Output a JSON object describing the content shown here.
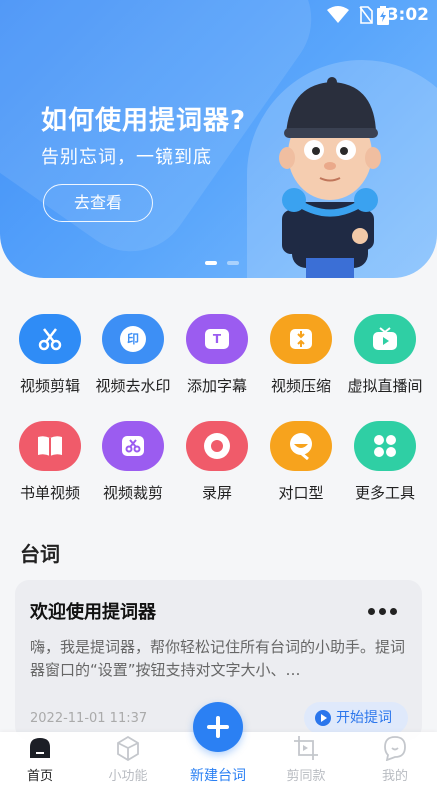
{
  "status_bar": {
    "time": "3:02"
  },
  "hero": {
    "title": "如何使用提词器?",
    "subtitle": "告别忘词，一镜到底",
    "button_label": "去查看"
  },
  "features": [
    {
      "label": "视频剪辑",
      "icon": "scissors-icon",
      "color": "#2f8cf6"
    },
    {
      "label": "视频去水印",
      "icon": "watermark-icon",
      "color": "#3d8ff5",
      "glyph": "印"
    },
    {
      "label": "添加字幕",
      "icon": "subtitle-icon",
      "color": "#9b5cf0",
      "glyph": "T"
    },
    {
      "label": "视频压缩",
      "icon": "compress-icon",
      "color": "#f7a31d"
    },
    {
      "label": "虚拟直播间",
      "icon": "live-tv-icon",
      "color": "#2fcfa4"
    },
    {
      "label": "书单视频",
      "icon": "book-icon",
      "color": "#f05b6a"
    },
    {
      "label": "视频裁剪",
      "icon": "crop-video-icon",
      "color": "#9b5cf0"
    },
    {
      "label": "录屏",
      "icon": "record-icon",
      "color": "#f05b6a"
    },
    {
      "label": "对口型",
      "icon": "lipsync-icon",
      "color": "#f7a31d"
    },
    {
      "label": "更多工具",
      "icon": "more-tools-icon",
      "color": "#2fcfa4"
    }
  ],
  "section": {
    "title": "台词"
  },
  "card": {
    "title": "欢迎使用提词器",
    "body": "嗨，我是提词器，帮你轻松记住所有台词的小助手。提词器窗口的“设置”按钮支持对文字大小、…",
    "date": "2022-11-01 11:37",
    "start_label": "开始提词"
  },
  "nav": {
    "items": [
      {
        "label": "首页"
      },
      {
        "label": "小功能"
      },
      {
        "label": "新建台词"
      },
      {
        "label": "剪同款"
      },
      {
        "label": "我的"
      }
    ]
  }
}
